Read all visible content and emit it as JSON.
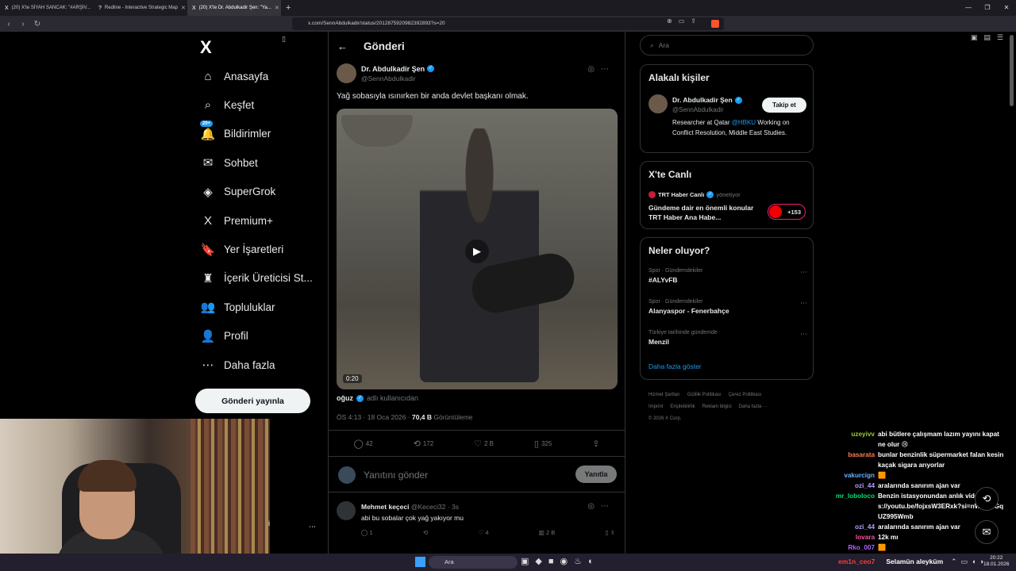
{
  "browser": {
    "tabs": [
      {
        "label": "(20) X'te SİYAH SANCAK: \"#ARŞİV...",
        "icon": "X"
      },
      {
        "label": "Redline - Interactive Strategic Map",
        "icon": "?"
      },
      {
        "label": "(20) X'te Dr. Abdulkadir Şen: \"Ya...",
        "icon": "X"
      }
    ],
    "url": "x.com/SennAbdulkadir/status/2012875920982392893?s=20"
  },
  "nav": {
    "logo": "X",
    "items": [
      {
        "label": "Anasayfa",
        "icon": "⌂"
      },
      {
        "label": "Keşfet",
        "icon": "⌕"
      },
      {
        "label": "Bildirimler",
        "icon": "🔔",
        "badge": "20+"
      },
      {
        "label": "Sohbet",
        "icon": "✉"
      },
      {
        "label": "SuperGrok",
        "icon": "◈"
      },
      {
        "label": "Premium+",
        "icon": "X"
      },
      {
        "label": "Yer İşaretleri",
        "icon": "🔖"
      },
      {
        "label": "İçerik Üreticisi St...",
        "icon": "♜"
      },
      {
        "label": "Topluluklar",
        "icon": "👥"
      },
      {
        "label": "Profil",
        "icon": "👤"
      },
      {
        "label": "Daha fazla",
        "icon": "⋯"
      }
    ],
    "post_button": "Gönderi yayınla"
  },
  "main": {
    "title": "Gönderi",
    "tweet": {
      "author_name": "Dr. Abdulkadir Şen",
      "author_handle": "@SennAbdulkadir",
      "text": "Yağ sobasıyla ısınırken bir anda devlet başkanı olmak.",
      "video_time": "0:20",
      "uploader_name": "oğuz",
      "uploader_suffix": "adlı kullanıcıdan",
      "time": "ÖS 4:13 · 18 Oca 2026 · ",
      "views": "70,4 B",
      "views_label": " Görüntüleme",
      "stats": {
        "replies": "42",
        "retweets": "172",
        "likes": "2 B",
        "bookmarks": "325"
      }
    },
    "reply_placeholder": "Yanıtını gönder",
    "reply_button": "Yanıtla",
    "comment": {
      "name": "Mehmet keçeci",
      "handle": "@Kececi32 · 3s",
      "text": "abi bu sobalar çok yağ yakıyor mu",
      "stats": {
        "replies": "1",
        "likes": "4",
        "views": "2 B"
      }
    }
  },
  "right": {
    "search_placeholder": "Ara",
    "related": {
      "title": "Alakalı kişiler",
      "name": "Dr. Abdulkadir Şen",
      "handle": "@SennAbdulkadir",
      "bio_pre": "Researcher at Qatar ",
      "bio_link": "@HBKU",
      "bio_post": " Working on Conflict Resolution, Middle East Studies.",
      "follow": "Takip et"
    },
    "live": {
      "title": "X'te Canlı",
      "host": "TRT Haber Canlı",
      "host_role": "yönetiyor",
      "text": "Gündeme dair en önemli konular TRT Haber Ana Habe...",
      "count": "+153"
    },
    "trends": {
      "title": "Neler oluyor?",
      "items": [
        {
          "category": "Spor · Gündemdekiler",
          "topic": "#ALYvFB"
        },
        {
          "category": "Spor · Gündemdekiler",
          "topic": "Alanyaspor - Fenerbahçe"
        },
        {
          "category": "Türkiye tarihinde gündemde",
          "topic": "Menzil"
        }
      ],
      "more": "Daha fazla göster"
    },
    "footer": [
      "Hizmet Şartları",
      "Gizlilik Politikası",
      "Çerez Politikası",
      "Imprint",
      "Erişilebilirlik",
      "Reklam bilgisi",
      "Daha fazla ···",
      "© 2026 X Corp."
    ]
  },
  "webcam": {
    "name": "i"
  },
  "chat": [
    {
      "user": "uzeyivv",
      "color": "#9acd32",
      "msg": "abi bütlere çalışmam lazım yayını kapat ne olur 😢"
    },
    {
      "user": "basarata",
      "color": "#ff7f50",
      "msg": "bunlar benzinlik süpermarket falan kesin kaçak sigara arıyorlar"
    },
    {
      "user": "vakurcign",
      "color": "#6ab0ff",
      "msg": "🟧"
    },
    {
      "user": "ozi_44",
      "color": "#b0a0ff",
      "msg": "aralarında sanırım ajan var"
    },
    {
      "user": "mr_loboloco",
      "color": "#00e070",
      "msg": "Benzin istasyonundan anlık video https://youtu.be/fojxsW3ERxk?si=nWdsSIGqUZ995Wmb"
    },
    {
      "user": "ozi_44",
      "color": "#b0a0ff",
      "msg": "aralarında sanırım ajan var"
    },
    {
      "user": "lovara",
      "color": "#ff4fa0",
      "msg": "12k mı"
    },
    {
      "user": "Rko_007",
      "color": "#b060ff",
      "msg": "🟧"
    }
  ],
  "taskbar": {
    "search": "Ara",
    "user": "em1n_ceo7",
    "message": "Selamün aleyküm",
    "time": "20:22",
    "date": "18.01.2026"
  }
}
